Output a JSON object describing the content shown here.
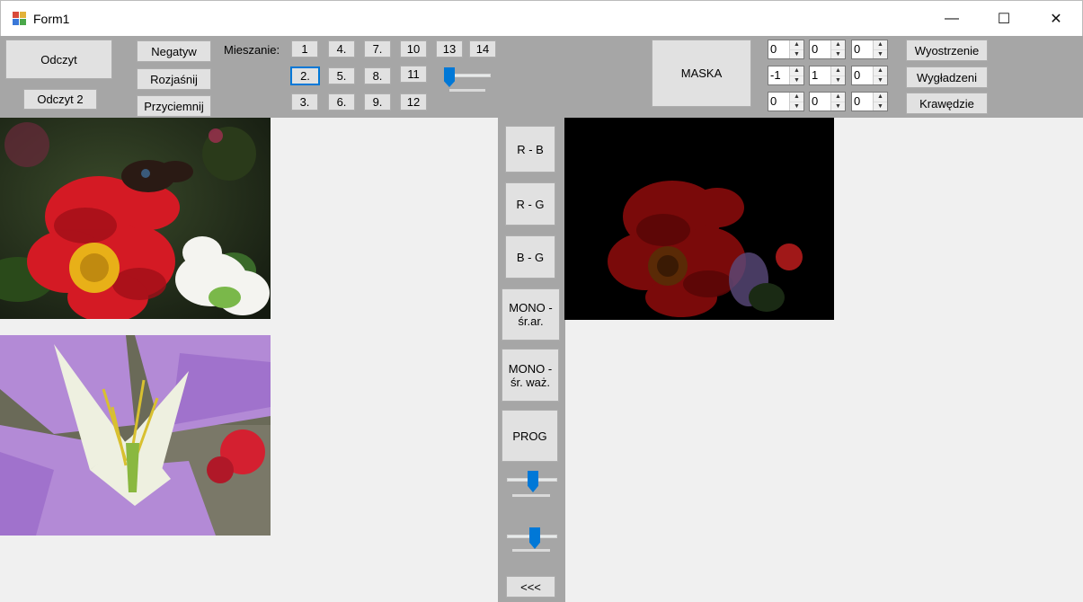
{
  "window": {
    "title": "Form1",
    "minimize_glyph": "—",
    "maximize_glyph": "☐",
    "close_glyph": "✕"
  },
  "toolbar": {
    "odczyt": "Odczyt",
    "odczyt2": "Odczyt 2",
    "negatyw": "Negatyw",
    "rozjasnij": "Rozjaśnij",
    "przyciemnij": "Przyciemnij",
    "mieszanie_label": "Mieszanie:",
    "blend_buttons": [
      "1",
      "4.",
      "7.",
      "10",
      "13",
      "14",
      "2.",
      "5.",
      "8.",
      "11",
      "3.",
      "6.",
      "9.",
      "12"
    ],
    "maska": "MASKA",
    "mask_values": [
      "0",
      "0",
      "0",
      "-1",
      "1",
      "0",
      "0",
      "0",
      "0"
    ],
    "wyostrzenie": "Wyostrzenie",
    "wygladzeni": "Wygładzeni",
    "krawedzie": "Krawędzie",
    "blend_slider_level": 0.05
  },
  "side_buttons": {
    "rb": "R - B",
    "rg": "R - G",
    "bg": "B - G",
    "mono_ar_1": "MONO -",
    "mono_ar_2": "śr.ar.",
    "mono_waz_1": "MONO -",
    "mono_waz_2": "śr. waż.",
    "prog": "PROG",
    "back": "<<<",
    "slider1_level": 0.5,
    "slider2_level": 0.55
  },
  "colors": {
    "accent": "#0078d7",
    "toolbar_bg": "#a6a6a6",
    "button_bg": "#e1e1e1"
  },
  "icons": {
    "app": "app-icon",
    "slider_thumb": "slider-thumb-icon"
  }
}
